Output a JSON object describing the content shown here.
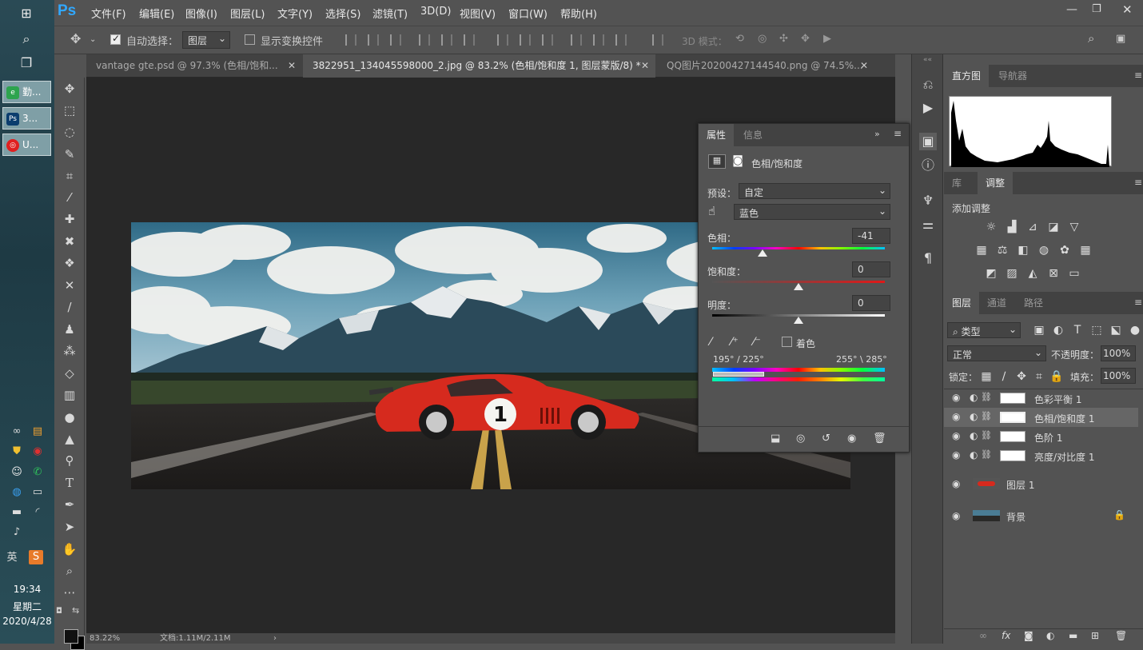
{
  "taskbar": {
    "apps": [
      {
        "label": "勤...",
        "color": "#2da44e"
      },
      {
        "label": "3...",
        "color": "#0b3d6e",
        "icon_text": "Ps"
      },
      {
        "label": "U...",
        "color": "#e02020"
      }
    ],
    "time": "19:34",
    "weekday": "星期二",
    "date": "2020/4/28",
    "ime": "英"
  },
  "menubar": {
    "logo": "Ps",
    "items": [
      "文件(F)",
      "编辑(E)",
      "图像(I)",
      "图层(L)",
      "文字(Y)",
      "选择(S)",
      "滤镜(T)",
      "3D(D)",
      "视图(V)",
      "窗口(W)",
      "帮助(H)"
    ]
  },
  "options": {
    "auto_select_label": "自动选择：",
    "auto_select_value": "图层",
    "show_transform_label": "显示变换控件",
    "mode_3d_label": "3D 模式："
  },
  "tabs": [
    {
      "label": "vantage gte.psd @ 97.3% (色相/饱和...",
      "active": false
    },
    {
      "label": "3822951_134045598000_2.jpg @ 83.2% (色相/饱和度 1, 图层蒙版/8) *",
      "active": true
    },
    {
      "label": "QQ图片20200427144540.png @ 74.5%...",
      "active": false
    }
  ],
  "status": {
    "zoom": "83.22%",
    "doc": "文档:1.11M/2.11M"
  },
  "properties": {
    "tabs": [
      "属性",
      "信息"
    ],
    "title": "色相/饱和度",
    "preset_label": "预设：",
    "preset_value": "自定",
    "channel_value": "蓝色",
    "hue_label": "色相：",
    "hue_value": "-41",
    "saturation_label": "饱和度：",
    "saturation_value": "0",
    "lightness_label": "明度：",
    "lightness_value": "0",
    "colorize_label": "着色",
    "range_left": "195° / 225°",
    "range_right": "255° \\ 285°",
    "hue_thumb_fraction": 0.29,
    "sat_thumb_fraction": 0.5,
    "light_thumb_fraction": 0.5
  },
  "histogram_panel": {
    "tabs": [
      "直方图",
      "导航器"
    ]
  },
  "adjustments_panel": {
    "tabs": [
      "库",
      "调整"
    ],
    "title": "添加调整"
  },
  "layers_panel": {
    "tabs": [
      "图层",
      "通道",
      "路径"
    ],
    "filter_value": "类型",
    "blend_mode": "正常",
    "opacity_label": "不透明度：",
    "opacity_value": "100%",
    "lock_label": "锁定：",
    "fill_label": "填充：",
    "fill_value": "100%",
    "layers": [
      {
        "name": "色彩平衡 1",
        "type": "adjustment",
        "selected": false
      },
      {
        "name": "色相/饱和度 1",
        "type": "adjustment",
        "selected": true
      },
      {
        "name": "色阶 1",
        "type": "adjustment",
        "selected": false
      },
      {
        "name": "亮度/对比度 1",
        "type": "adjustment",
        "selected": false
      },
      {
        "name": "图层 1",
        "type": "pixel",
        "selected": false
      },
      {
        "name": "背景",
        "type": "background",
        "selected": false
      }
    ]
  },
  "colors": {
    "ui_bg": "#535353",
    "canvas_bg": "#282828",
    "car_red": "#d62a1e"
  }
}
